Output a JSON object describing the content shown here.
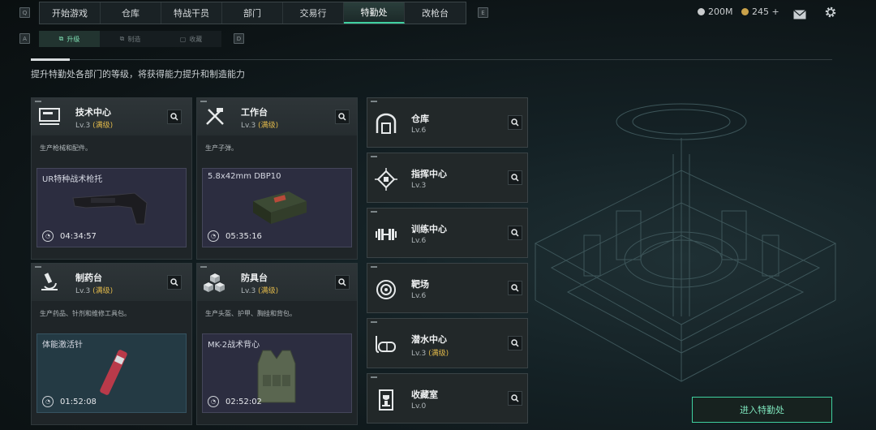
{
  "nav": {
    "key_left": "Q",
    "key_right": "E",
    "tabs": [
      {
        "label": "开始游戏"
      },
      {
        "label": "仓库"
      },
      {
        "label": "特战干员"
      },
      {
        "label": "部门"
      },
      {
        "label": "交易行"
      },
      {
        "label": "特勤处",
        "active": true
      },
      {
        "label": "改枪台"
      }
    ],
    "currency_1": "200M",
    "currency_2": "245 +"
  },
  "subnav": {
    "key_left": "A",
    "key_right": "D",
    "tabs": [
      {
        "label": "升级",
        "active": true
      },
      {
        "label": "制造"
      },
      {
        "label": "收藏"
      }
    ]
  },
  "intro": "提升特勤处各部门的等级，将获得能力提升和制造能力",
  "cards": [
    {
      "title": "技术中心",
      "level": "Lv.3",
      "max": "(满级)",
      "desc": "生产枪械和配件。",
      "product": "UR特种战术枪托",
      "timer": "04:34:57",
      "icon": "computer-icon"
    },
    {
      "title": "工作台",
      "level": "Lv.3",
      "max": "(满级)",
      "desc": "生产子弹。",
      "product": "5.8x42mm DBP10",
      "timer": "05:35:16",
      "icon": "tools-icon"
    },
    {
      "title": "制药台",
      "level": "Lv.3",
      "max": "(满级)",
      "desc": "生产药品、针剂和维修工具包。",
      "product": "体能激活针",
      "timer": "01:52:08",
      "icon": "microscope-icon"
    },
    {
      "title": "防具台",
      "level": "Lv.3",
      "max": "(满级)",
      "desc": "生产头盔、护甲、胸挂和背包。",
      "product": "MK-2战术背心",
      "timer": "02:52:02",
      "icon": "armor-cubes-icon"
    }
  ],
  "facilities": [
    {
      "title": "仓库",
      "level": "Lv.6",
      "max": "",
      "icon": "warehouse-icon"
    },
    {
      "title": "指挥中心",
      "level": "Lv.3",
      "max": "",
      "icon": "chip-icon"
    },
    {
      "title": "训练中心",
      "level": "Lv.6",
      "max": "",
      "icon": "dumbbell-icon"
    },
    {
      "title": "靶场",
      "level": "Lv.6",
      "max": "",
      "icon": "target-icon"
    },
    {
      "title": "潜水中心",
      "level": "Lv.3",
      "max": "(满级)",
      "icon": "diving-mask-icon"
    },
    {
      "title": "收藏室",
      "level": "Lv.0",
      "max": "",
      "icon": "trophy-icon"
    }
  ],
  "enter_button": "进入特勤处",
  "colors": {
    "accent": "#3fd0a0",
    "max_level": "#e0b84a"
  }
}
